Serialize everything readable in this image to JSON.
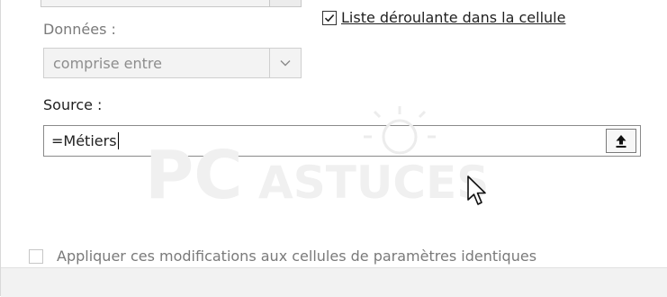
{
  "settings": {
    "data_label": "Données :",
    "dropdown_in_cell_label": "Liste déroulante dans la cellule",
    "dropdown_in_cell_checked": true,
    "data_operator_value": "comprise entre",
    "source_label": "Source :",
    "source_value": "=Métiers",
    "apply_changes_label": "Appliquer ces modifications aux cellules de paramètres identiques",
    "apply_changes_checked": false
  },
  "icons": {
    "combo_arrow": "chevron-down-icon",
    "collapse_dialog": "range-collapse-arrow-icon",
    "pointer": "mouse-pointer-icon",
    "watermark": "pc-astuces-watermark"
  },
  "watermark": {
    "text_pc": "PC",
    "text_astuces": "ASTUCES"
  },
  "colors": {
    "label_gray": "#7a7a7a",
    "disabled_bg": "#f3f3f3",
    "border_dark": "#8a8a8a"
  }
}
